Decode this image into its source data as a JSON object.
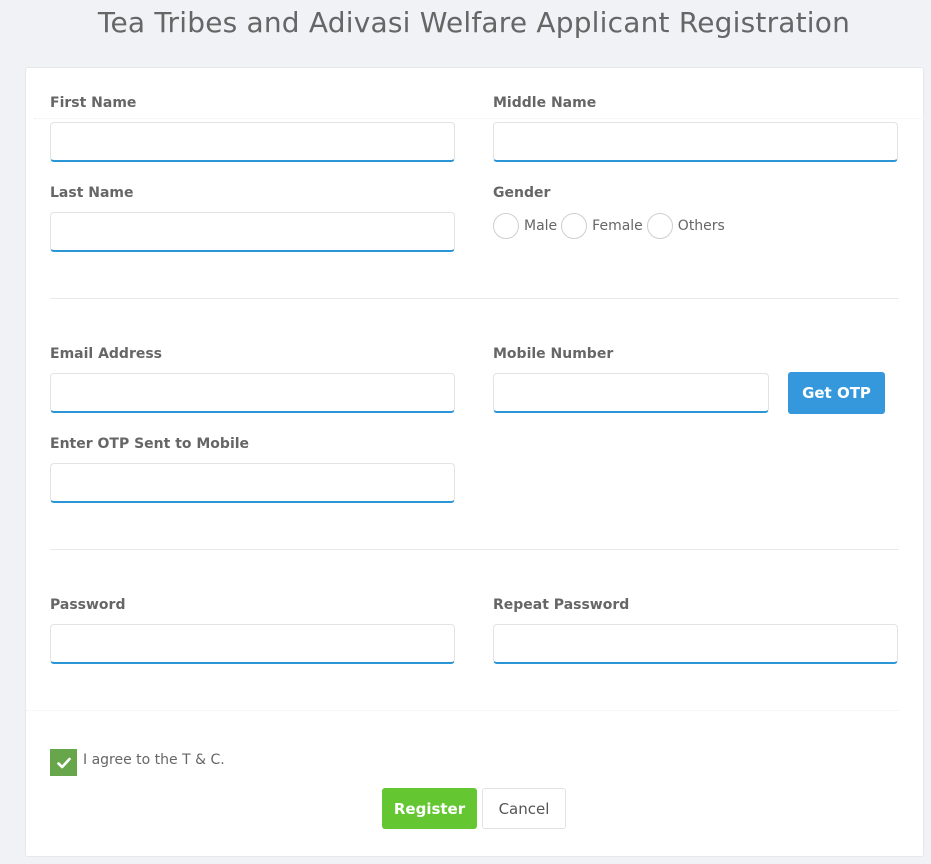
{
  "header": {
    "title": "Tea Tribes and Adivasi Welfare Applicant Registration"
  },
  "form": {
    "first_name": {
      "label": "First Name",
      "value": "",
      "placeholder": ""
    },
    "middle_name": {
      "label": "Middle Name",
      "value": "",
      "placeholder": ""
    },
    "last_name": {
      "label": "Last Name",
      "value": "",
      "placeholder": ""
    },
    "gender": {
      "label": "Gender",
      "options": [
        {
          "label": "Male",
          "selected": false
        },
        {
          "label": "Female",
          "selected": false
        },
        {
          "label": "Others",
          "selected": false
        }
      ]
    },
    "email": {
      "label": "Email Address",
      "value": "",
      "placeholder": ""
    },
    "mobile": {
      "label": "Mobile Number",
      "value": "",
      "placeholder": ""
    },
    "get_otp_label": "Get OTP",
    "otp": {
      "label": "Enter OTP Sent to Mobile",
      "value": "",
      "placeholder": ""
    },
    "password": {
      "label": "Password",
      "value": "",
      "placeholder": ""
    },
    "repeat_password": {
      "label": "Repeat Password",
      "value": "",
      "placeholder": ""
    },
    "terms": {
      "label": "I agree to the T & C.",
      "checked": true,
      "icon": "check-icon"
    },
    "register_label": "Register",
    "cancel_label": "Cancel"
  },
  "colors": {
    "primary_blue": "#3598dc",
    "input_focus_border": "#2a96d6",
    "register_green": "#64c732",
    "checkbox_green": "#67a64a",
    "page_background": "#f1f2f5"
  }
}
